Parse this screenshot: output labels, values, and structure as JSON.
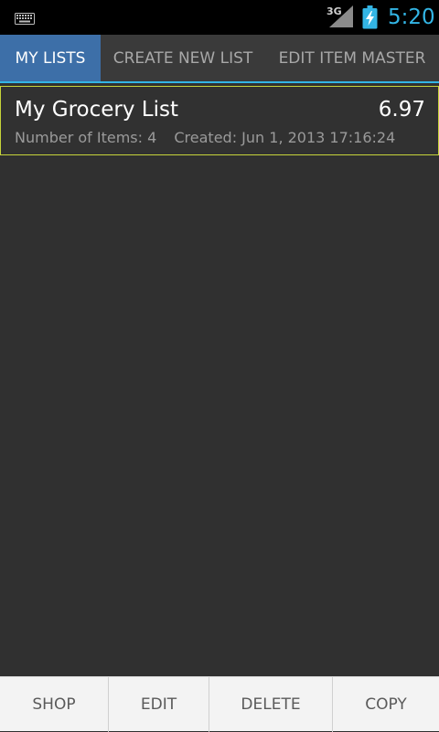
{
  "status_bar": {
    "network": "3G",
    "time": "5:20",
    "icons": [
      "keyboard-icon",
      "signal-icon",
      "battery-charging-icon"
    ],
    "clock_color": "#33b5e5"
  },
  "tabs": [
    {
      "label": "MY LISTS",
      "active": true
    },
    {
      "label": "CREATE NEW LIST",
      "active": false
    },
    {
      "label": "EDIT ITEM MASTER",
      "active": false
    }
  ],
  "lists": [
    {
      "name": "My Grocery List",
      "total": "6.97",
      "items_count": "Number of Items: 4",
      "created": "Created: Jun 1, 2013 17:16:24"
    }
  ],
  "actions": [
    {
      "label": "SHOP"
    },
    {
      "label": "EDIT"
    },
    {
      "label": "DELETE"
    },
    {
      "label": "COPY"
    }
  ],
  "colors": {
    "accent": "#33b5e5",
    "active_tab": "#3d6fa8",
    "selection_border": "#c6d43a",
    "background": "#303030"
  }
}
